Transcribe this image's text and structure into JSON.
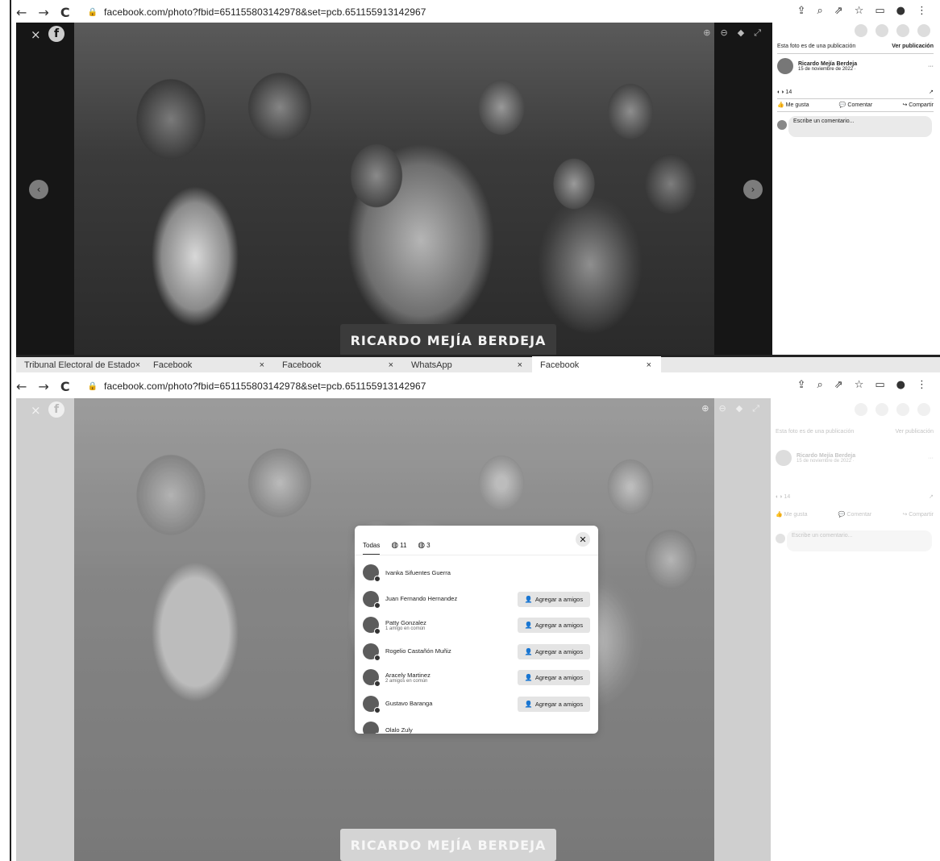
{
  "top": {
    "address": {
      "url": "facebook.com/photo?fbid=651155803142978&set=pcb.651155913142967"
    },
    "photo": {
      "podium_text": "RICARDO MEJÍA BERDEJA"
    },
    "side": {
      "post_notice": "Esta foto es de una publicación",
      "view_post": "Ver publicación",
      "poster_name": "Ricardo Mejía Berdeja",
      "poster_date": "15 de noviembre de 2022 ·",
      "reaction_count": "14",
      "like": "Me gusta",
      "comment": "Comentar",
      "share": "Compartir",
      "comment_placeholder": "Escribe un comentario..."
    }
  },
  "tabstrip": {
    "tabs": [
      {
        "label": "Tribunal Electoral de Estado"
      },
      {
        "label": "Facebook"
      },
      {
        "label": "Facebook"
      },
      {
        "label": "WhatsApp"
      },
      {
        "label": "Facebook"
      }
    ]
  },
  "bottom": {
    "address": {
      "url": "facebook.com/photo?fbid=651155803142978&set=pcb.651155913142967"
    },
    "photo": {
      "podium_text": "RICARDO MEJÍA BERDEJA"
    },
    "dialog": {
      "tabs": [
        {
          "label": "Todas"
        },
        {
          "label": "11"
        },
        {
          "label": "3"
        }
      ],
      "people": [
        {
          "name": "Ivanka Sifuentes Guerra",
          "sub": "",
          "action": ""
        },
        {
          "name": "Juan Fernando Hernandez",
          "sub": "",
          "action": "Agregar a amigos"
        },
        {
          "name": "Patty Gonzalez",
          "sub": "1 amigo en común",
          "action": "Agregar a amigos"
        },
        {
          "name": "Rogelio Castañón Muñiz",
          "sub": "",
          "action": "Agregar a amigos"
        },
        {
          "name": "Aracely Martinez",
          "sub": "2 amigos en común",
          "action": "Agregar a amigos"
        },
        {
          "name": "Gustavo Baranga",
          "sub": "",
          "action": "Agregar a amigos"
        },
        {
          "name": "Olalo Zuly",
          "sub": "",
          "action": ""
        }
      ]
    }
  }
}
